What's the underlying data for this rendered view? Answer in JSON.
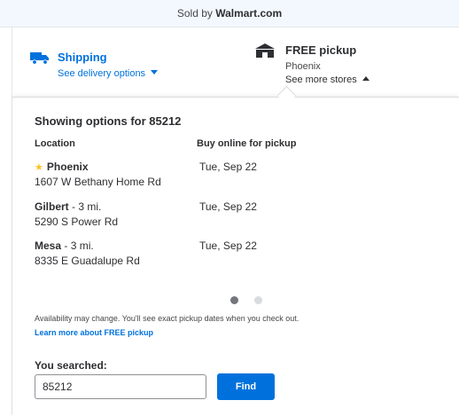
{
  "seller": {
    "prefix": "Sold by",
    "name": "Walmart.com"
  },
  "shipping": {
    "title": "Shipping",
    "options_link": "See delivery options",
    "icon": "truck-icon"
  },
  "pickup": {
    "title": "FREE pickup",
    "city": "Phoenix",
    "more_stores": "See more stores",
    "icon": "store-icon"
  },
  "stores_panel": {
    "heading": "Showing options for 85212",
    "col_location": "Location",
    "col_pickup": "Buy online for pickup",
    "rows": [
      {
        "name": "Phoenix",
        "distance": "",
        "address": "1607 W Bethany Home Rd",
        "date": "Tue, Sep 22",
        "preferred": true
      },
      {
        "name": "Gilbert",
        "distance": " - 3 mi.",
        "address": "5290 S Power Rd",
        "date": "Tue, Sep 22",
        "preferred": false
      },
      {
        "name": "Mesa",
        "distance": " - 3 mi.",
        "address": "8335 E Guadalupe Rd",
        "date": "Tue, Sep 22",
        "preferred": false
      }
    ],
    "pagination": {
      "current": 1,
      "total": 2
    },
    "availability_note": "Availability may change. You'll see exact pickup dates when you check out.",
    "learn_more": "Learn more about FREE pickup"
  },
  "search": {
    "label": "You searched:",
    "value": "85212",
    "button": "Find"
  },
  "colors": {
    "brand_blue": "#0071dc",
    "star_yellow": "#ffc220",
    "dot_active": "#74767c",
    "dot_inactive": "#d9dbdf"
  }
}
